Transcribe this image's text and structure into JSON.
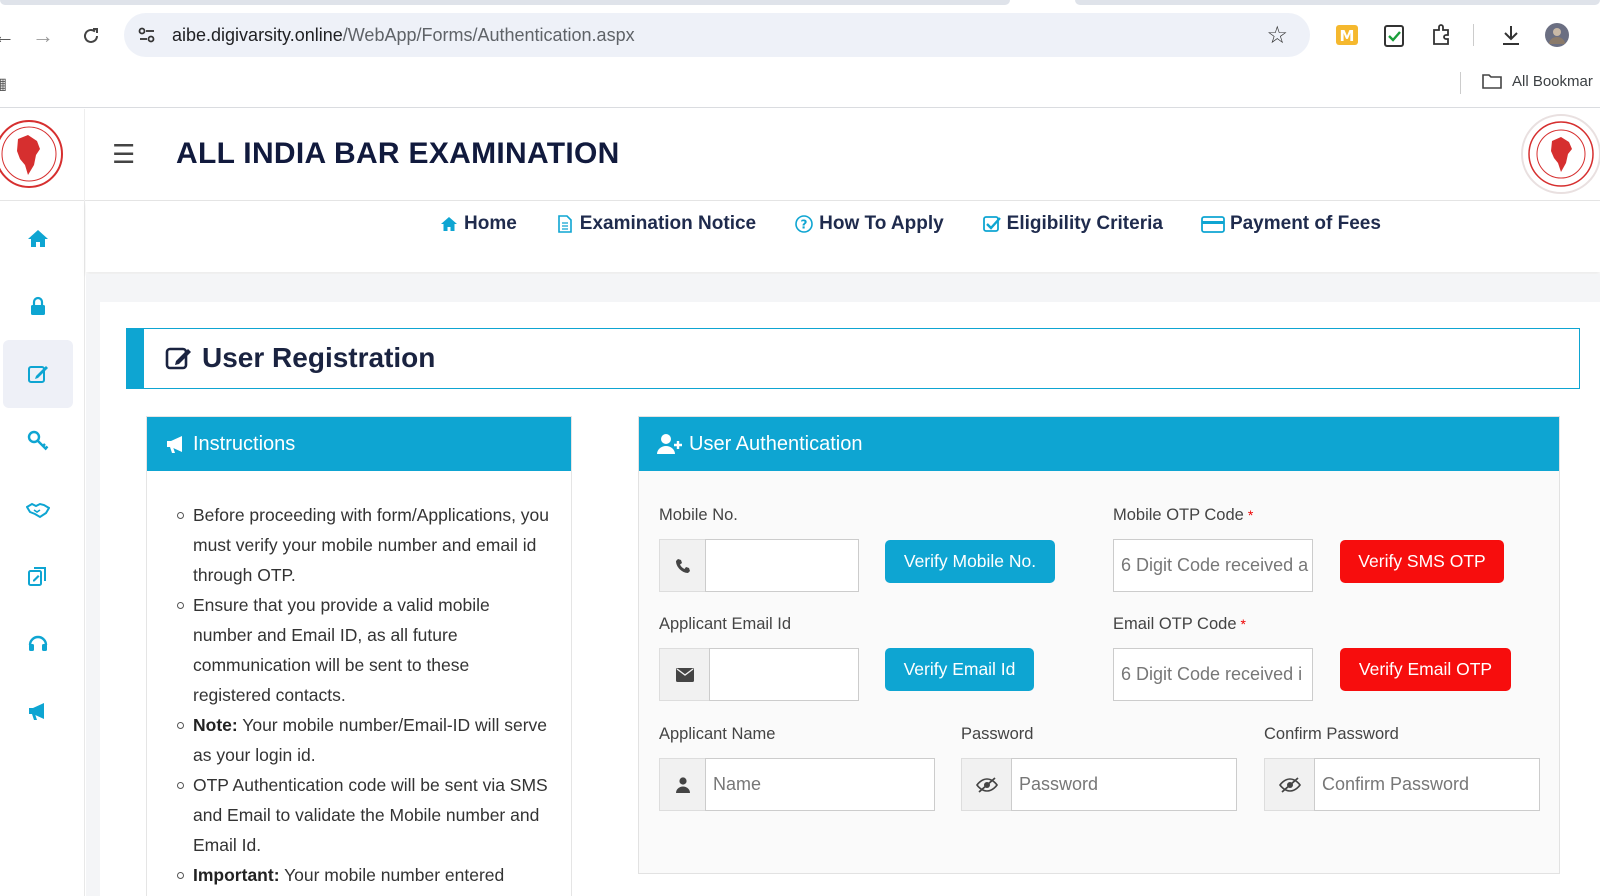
{
  "browser": {
    "url_host": "aibe.digivarsity.online",
    "url_path": "/WebApp/Forms/Authentication.aspx",
    "bookmarks_label": "All Bookmar"
  },
  "header": {
    "title": "ALL INDIA BAR EXAMINATION"
  },
  "topnav": [
    {
      "label": "Home",
      "icon": "home-icon"
    },
    {
      "label": "Examination Notice",
      "icon": "document-icon"
    },
    {
      "label": "How To Apply",
      "icon": "question-circle-icon"
    },
    {
      "label": "Eligibility Criteria",
      "icon": "check-square-icon"
    },
    {
      "label": "Payment of Fees",
      "icon": "credit-card-icon"
    }
  ],
  "sidebar": [
    {
      "icon": "home-icon"
    },
    {
      "icon": "lock-icon"
    },
    {
      "icon": "edit-icon",
      "active": true
    },
    {
      "icon": "key-icon"
    },
    {
      "icon": "handshake-icon"
    },
    {
      "icon": "copy-edit-icon"
    },
    {
      "icon": "headset-icon"
    },
    {
      "icon": "megaphone-icon"
    }
  ],
  "page": {
    "title": "User Registration"
  },
  "instructions": {
    "title": "Instructions",
    "items": [
      {
        "bold": "",
        "text": "Before proceeding with form/Applications, you must verify your mobile number and email id through OTP."
      },
      {
        "bold": "",
        "text": "Ensure that you provide a valid mobile number and Email ID, as all future communication will be sent to these registered contacts."
      },
      {
        "bold": "Note:",
        "text": " Your mobile number/Email-ID will serve as your login id."
      },
      {
        "bold": "",
        "text": "OTP Authentication code will be sent via SMS and Email to validate the Mobile number and Email Id."
      },
      {
        "bold": "Important:",
        "text": " Your mobile number entered"
      }
    ]
  },
  "auth": {
    "title": "User Authentication",
    "mobile_label": "Mobile No.",
    "mobile_value": "",
    "verify_mobile": "Verify Mobile No.",
    "mobile_otp_label": "Mobile OTP Code",
    "mobile_otp_placeholder": "6 Digit Code received a",
    "verify_sms_otp": "Verify SMS OTP",
    "email_label": "Applicant Email Id",
    "email_value": "",
    "verify_email": "Verify Email Id",
    "email_otp_label": "Email OTP Code",
    "email_otp_placeholder": "6 Digit Code received i",
    "verify_email_otp": "Verify Email OTP",
    "name_label": "Applicant Name",
    "name_placeholder": "Name",
    "password_label": "Password",
    "password_placeholder": "Password",
    "confirm_label": "Confirm Password",
    "confirm_placeholder": "Confirm Password",
    "required_mark": "*"
  },
  "colors": {
    "accent": "#0ea5d2",
    "danger": "#f70d0d",
    "title": "#111a3d"
  }
}
